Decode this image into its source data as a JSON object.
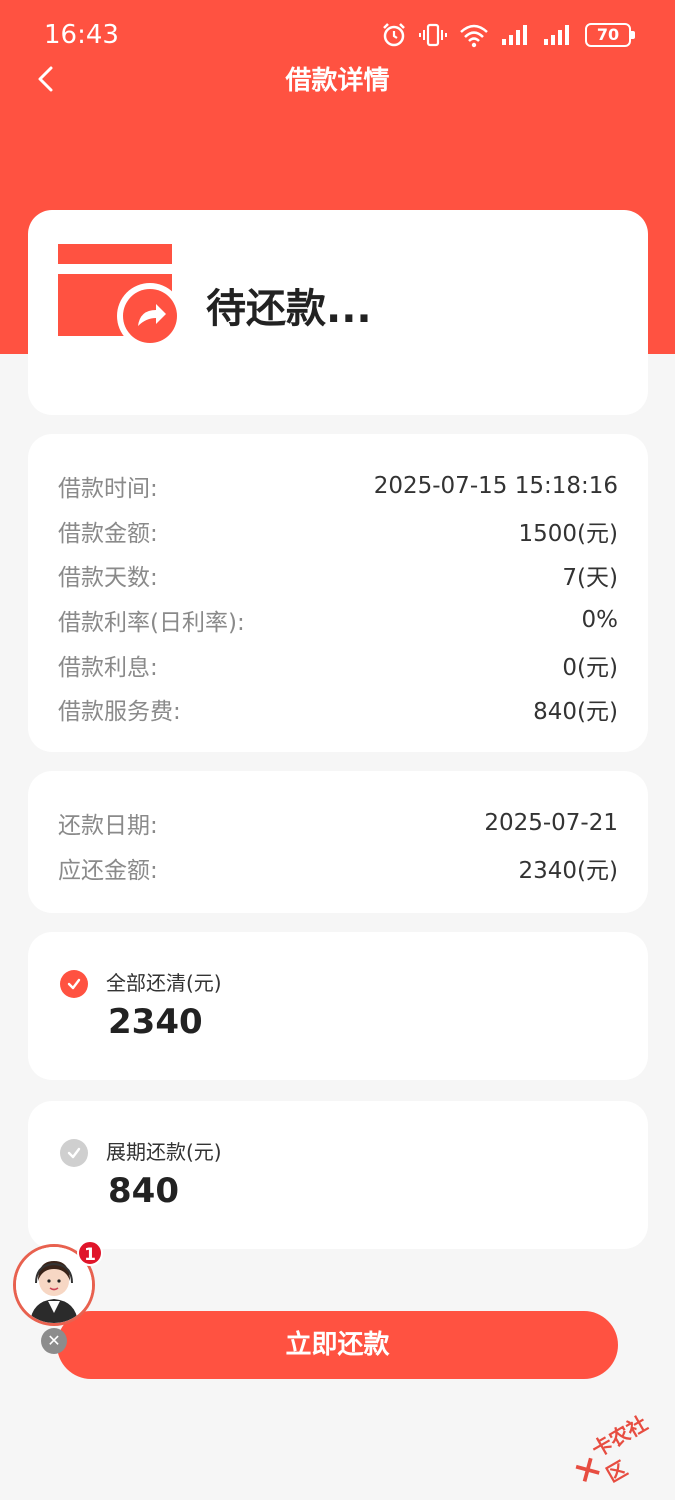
{
  "status_bar": {
    "time": "16:43",
    "battery": "70",
    "icons": [
      "alarm-icon",
      "vibrate-icon",
      "wifi-icon",
      "signal-icon",
      "signal-icon",
      "battery-icon"
    ]
  },
  "nav": {
    "back_icon": "chevron-left-icon",
    "title": "借款详情"
  },
  "status_card": {
    "icon": "card-refund-icon",
    "text": "待还款..."
  },
  "loan_info": [
    {
      "label": "借款时间:",
      "value": "2025-07-15 15:18:16"
    },
    {
      "label": "借款金额:",
      "value": "1500(元)"
    },
    {
      "label": "借款天数:",
      "value": "7(天)"
    },
    {
      "label": "借款利率(日利率):",
      "value": "0%"
    },
    {
      "label": "借款利息:",
      "value": "0(元)"
    },
    {
      "label": "借款服务费:",
      "value": "840(元)"
    }
  ],
  "repay_info": [
    {
      "label": "还款日期:",
      "value": "2025-07-21"
    },
    {
      "label": "应还金额:",
      "value": "2340(元)"
    }
  ],
  "options": [
    {
      "label": "全部还清(元)",
      "amount": "2340",
      "selected": true
    },
    {
      "label": "展期还款(元)",
      "amount": "840",
      "selected": false
    }
  ],
  "pay_button": "立即还款",
  "agent": {
    "badge_count": "1",
    "close_icon": "close-icon"
  },
  "watermark": "卡农社区",
  "colors": {
    "accent": "#ff5241",
    "card": "#ffffff",
    "background": "#f6f6f6"
  }
}
